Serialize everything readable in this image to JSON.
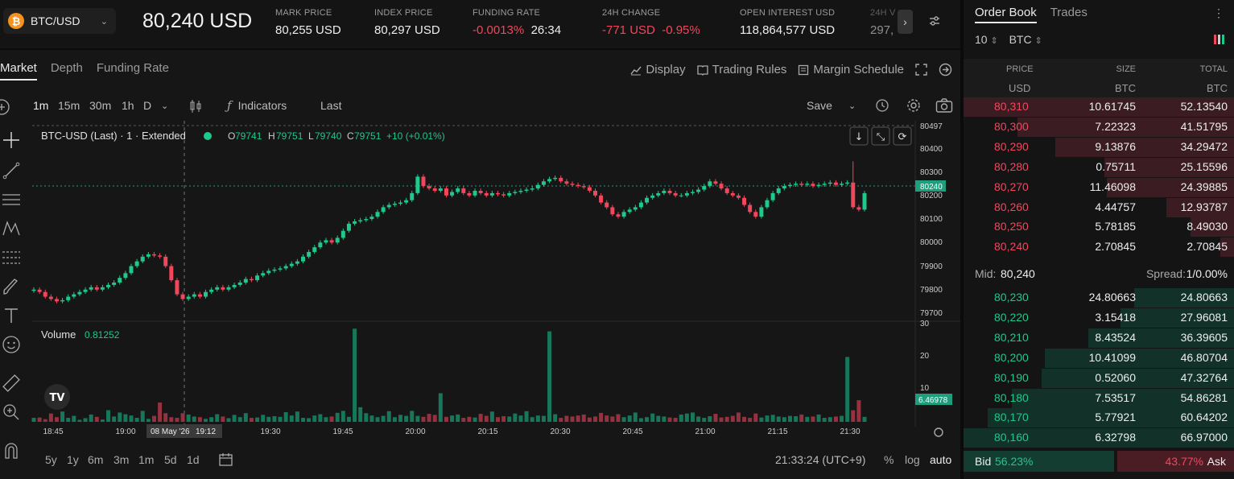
{
  "header": {
    "pair": "BTC/USD",
    "last_price": "80,240 USD",
    "stats": [
      {
        "label": "MARK PRICE",
        "value": "80,255 USD"
      },
      {
        "label": "INDEX PRICE",
        "value": "80,297 USD"
      },
      {
        "label": "FUNDING RATE",
        "value": "-0.0013%",
        "extra": "26:34"
      },
      {
        "label": "24H CHANGE",
        "value": "-771 USD",
        "extra": "-0.95%"
      },
      {
        "label": "OPEN INTEREST USD",
        "value": "118,864,577 USD"
      },
      {
        "label": "24H V",
        "value": "297,"
      }
    ]
  },
  "chart_tabs": [
    "Market",
    "Depth",
    "Funding Rate"
  ],
  "chart_tools": {
    "display": "Display",
    "rules": "Trading Rules",
    "margin": "Margin Schedule"
  },
  "toolbar": {
    "timeframes": [
      "1m",
      "15m",
      "30m",
      "1h",
      "D"
    ],
    "indicators": "Indicators",
    "last": "Last",
    "save": "Save"
  },
  "legend": {
    "title": "BTC-USD (Last) · 1 · Extended",
    "o_lbl": "O",
    "o": "79741",
    "h_lbl": "H",
    "h": "79751",
    "l_lbl": "L",
    "l": "79740",
    "c_lbl": "C",
    "c": "79751",
    "change": "+10 (+0.01%)",
    "volume_lbl": "Volume",
    "volume": "0.81252"
  },
  "price_axis": [
    "80497",
    "80400",
    "80300",
    "80240",
    "80200",
    "80100",
    "80000",
    "79900",
    "79800",
    "79700"
  ],
  "volume_axis": [
    "30",
    "20",
    "10",
    "6.46978"
  ],
  "time_axis": [
    "18:45",
    "19:00",
    "08 May '26",
    "19:12",
    "19:30",
    "19:45",
    "20:00",
    "20:15",
    "20:30",
    "20:45",
    "21:00",
    "21:15",
    "21:30"
  ],
  "bottom": {
    "ranges": [
      "5y",
      "1y",
      "6m",
      "3m",
      "1m",
      "5d",
      "1d"
    ],
    "clock": "21:33:24 (UTC+9)",
    "pct": "%",
    "log": "log",
    "auto": "auto"
  },
  "order_book": {
    "tabs": [
      "Order Book",
      "Trades"
    ],
    "depth": "10",
    "unit": "BTC",
    "head": {
      "price": "PRICE",
      "size": "SIZE",
      "total": "TOTAL",
      "pu": "USD",
      "su": "BTC",
      "tu": "BTC"
    },
    "asks": [
      {
        "price": "80,310",
        "size": "10.61745",
        "total": "52.13540",
        "depth": 1.0
      },
      {
        "price": "80,300",
        "size": "7.22323",
        "total": "41.51795",
        "depth": 0.8
      },
      {
        "price": "80,290",
        "size": "9.13876",
        "total": "34.29472",
        "depth": 0.66
      },
      {
        "price": "80,280",
        "size": "0.75711",
        "total": "25.15596",
        "depth": 0.48
      },
      {
        "price": "80,270",
        "size": "11.46098",
        "total": "24.39885",
        "depth": 0.47
      },
      {
        "price": "80,260",
        "size": "4.44757",
        "total": "12.93787",
        "depth": 0.25
      },
      {
        "price": "80,250",
        "size": "5.78185",
        "total": "8.49030",
        "depth": 0.16
      },
      {
        "price": "80,240",
        "size": "2.70845",
        "total": "2.70845",
        "depth": 0.05
      }
    ],
    "mid_lbl": "Mid:",
    "mid": "80,240",
    "spread_lbl": "Spread:",
    "spread": "1/0.00%",
    "bids": [
      {
        "price": "80,230",
        "size": "24.80663",
        "total": "24.80663",
        "depth": 0.37
      },
      {
        "price": "80,220",
        "size": "3.15418",
        "total": "27.96081",
        "depth": 0.42
      },
      {
        "price": "80,210",
        "size": "8.43524",
        "total": "36.39605",
        "depth": 0.54
      },
      {
        "price": "80,200",
        "size": "10.41099",
        "total": "46.80704",
        "depth": 0.7
      },
      {
        "price": "80,190",
        "size": "0.52060",
        "total": "47.32764",
        "depth": 0.71
      },
      {
        "price": "80,180",
        "size": "7.53517",
        "total": "54.86281",
        "depth": 0.82
      },
      {
        "price": "80,170",
        "size": "5.77921",
        "total": "60.64202",
        "depth": 0.91
      },
      {
        "price": "80,160",
        "size": "6.32798",
        "total": "66.97000",
        "depth": 1.0
      }
    ],
    "bid_lbl": "Bid",
    "bid_pct": "56.23%",
    "ask_pct": "43.77%",
    "ask_lbl": "Ask",
    "bid_ratio": 0.5623
  },
  "colors": {
    "up": "#1fc88b",
    "down": "#f0475d",
    "accent": "#1e9e7d"
  }
}
